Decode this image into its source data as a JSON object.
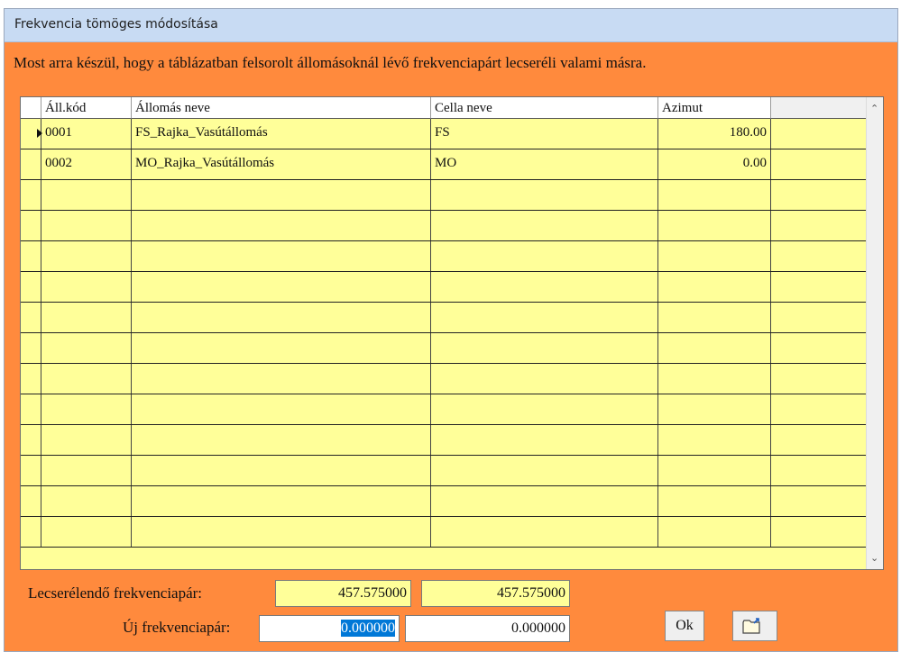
{
  "window": {
    "title": "Frekvencia tömöges módosítása",
    "message": "Most arra készül, hogy a táblázatban felsorolt állomásoknál lévő frekvenciapárt lecseréli valami másra."
  },
  "table": {
    "columns": [
      "Áll.kód",
      "Állomás neve",
      "Cella neve",
      "Azimut"
    ],
    "rows": [
      {
        "code": "0001",
        "station": "FS_Rajka_Vasútállomás",
        "cell": "FS",
        "azimuth": "180.00",
        "current": true
      },
      {
        "code": "0002",
        "station": "MO_Rajka_Vasútállomás",
        "cell": "MO",
        "azimuth": "0.00",
        "current": false
      }
    ],
    "empty_rows": 12
  },
  "form": {
    "replace_label": "Lecserélendő frekvenciapár:",
    "replace_value_1": "457.575000",
    "replace_value_2": "457.575000",
    "new_label": "Új frekvenciapár:",
    "new_value_1": "0.000000",
    "new_value_2": "0.000000"
  },
  "buttons": {
    "ok_label": "Ok",
    "open_icon": "folder-open-icon"
  },
  "colors": {
    "window_bg": "#ff8a3d",
    "grid_cell_bg": "#ffff99",
    "selection": "#0078d7",
    "titlebar": "#c8dbf3"
  }
}
